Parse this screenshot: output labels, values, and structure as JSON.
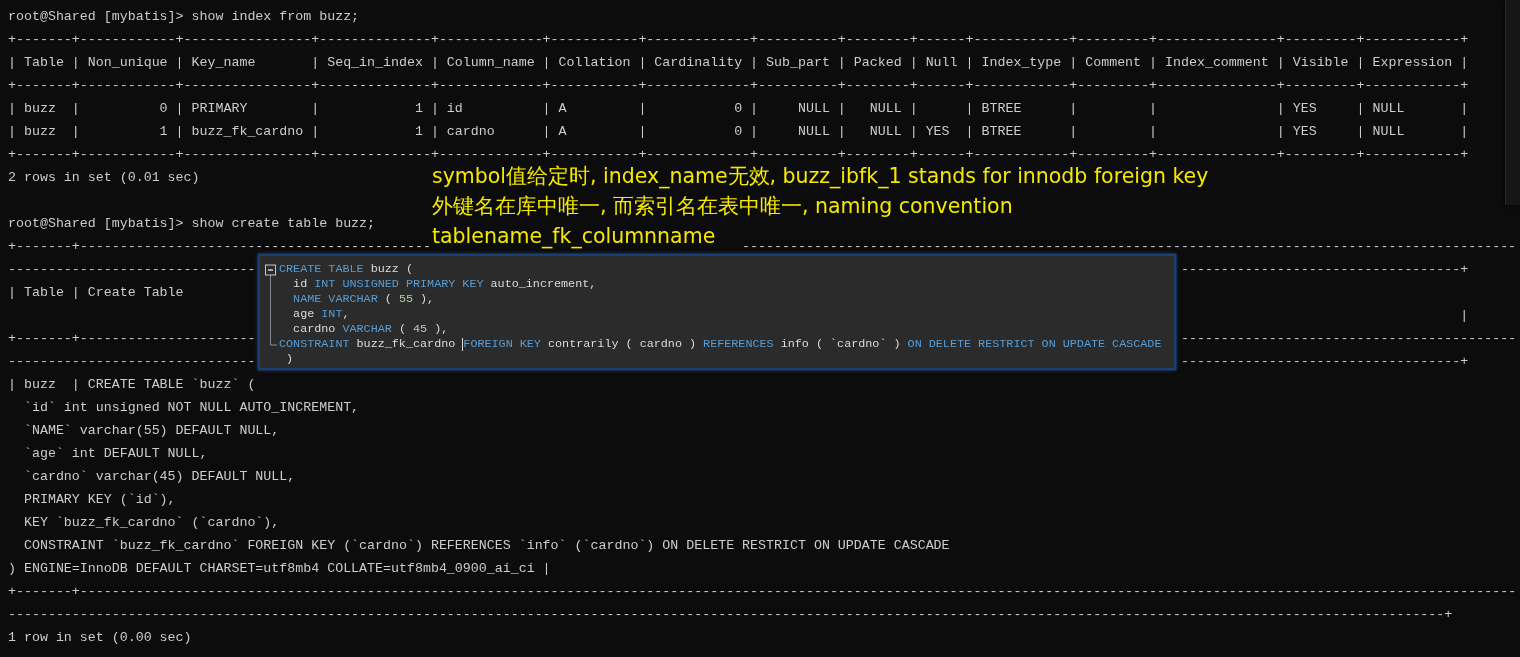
{
  "terminal": {
    "lines": [
      {
        "kind": "text",
        "text": "root@Shared [mybatis]> show index from buzz;"
      },
      {
        "kind": "text",
        "text": "+-------+------------+----------------+--------------+-------------+-----------+-------------+----------+--------+------+------------+---------+---------------+---------+------------+"
      },
      {
        "kind": "text",
        "text": "| Table | Non_unique | Key_name       | Seq_in_index | Column_name | Collation | Cardinality | Sub_part | Packed | Null | Index_type | Comment | Index_comment | Visible | Expression |"
      },
      {
        "kind": "text",
        "text": "+-------+------------+----------------+--------------+-------------+-----------+-------------+----------+--------+------+------------+---------+---------------+---------+------------+"
      },
      {
        "kind": "text",
        "text": "| buzz  |          0 | PRIMARY        |            1 | id          | A         |           0 |     NULL |   NULL |      | BTREE      |         |               | YES     | NULL       |"
      },
      {
        "kind": "text",
        "text": "| buzz  |          1 | buzz_fk_cardno |            1 | cardno      | A         |           0 |     NULL |   NULL | YES  | BTREE      |         |               | YES     | NULL       |"
      },
      {
        "kind": "text",
        "text": "+-------+------------+----------------+--------------+-------------+-----------+-------------+----------+--------+------+------------+---------+---------------+---------+------------+"
      },
      {
        "kind": "text",
        "text": "2 rows in set (0.01 sec)"
      },
      {
        "kind": "blank"
      },
      {
        "kind": "text",
        "text": "root@Shared [mybatis]> show create table buzz;"
      },
      {
        "kind": "split_wide",
        "left": "+-------+--------------------------------------------",
        "right": "-------------------------------------------------------------------------------------------------"
      },
      {
        "kind": "split",
        "left": "-------------------------------",
        "right": "-----------------------------------+"
      },
      {
        "kind": "text",
        "text": "| Table | Create Table"
      },
      {
        "kind": "right",
        "text": "|"
      },
      {
        "kind": "split_wide",
        "left": "+-------+----------------------",
        "right": "------------------------------------------"
      },
      {
        "kind": "split",
        "left": "-------------------------------",
        "right": "-----------------------------------+"
      },
      {
        "kind": "text",
        "text": "| buzz  | CREATE TABLE `buzz` ("
      },
      {
        "kind": "text",
        "text": "  `id` int unsigned NOT NULL AUTO_INCREMENT,"
      },
      {
        "kind": "text",
        "text": "  `NAME` varchar(55) DEFAULT NULL,"
      },
      {
        "kind": "text",
        "text": "  `age` int DEFAULT NULL,"
      },
      {
        "kind": "text",
        "text": "  `cardno` varchar(45) DEFAULT NULL,"
      },
      {
        "kind": "text",
        "text": "  PRIMARY KEY (`id`),"
      },
      {
        "kind": "text",
        "text": "  KEY `buzz_fk_cardno` (`cardno`),"
      },
      {
        "kind": "text",
        "text": "  CONSTRAINT `buzz_fk_cardno` FOREIGN KEY (`cardno`) REFERENCES `info` (`cardno`) ON DELETE RESTRICT ON UPDATE CASCADE"
      },
      {
        "kind": "text",
        "text": ") ENGINE=InnoDB DEFAULT CHARSET=utf8mb4 COLLATE=utf8mb4_0900_ai_ci |"
      },
      {
        "kind": "text",
        "text": "+-------+------------------------------------------------------------------------------------------------------------------------------------------------------------------------------------"
      },
      {
        "kind": "text",
        "text": "------------------------------------------------------------------------------------------------------------------------------------------------------------------------------------+"
      },
      {
        "kind": "text",
        "text": "1 row in set (0.00 sec)"
      }
    ]
  },
  "annotation": {
    "lines": [
      "symbol值给定时, index_name无效, buzz_ibfk_1 stands for innodb foreign key",
      "外键名在库中唯一, 而索引名在表中唯一, naming convention",
      "tablename_fk_columnname"
    ]
  },
  "popup": {
    "lines": [
      [
        {
          "kind": "keyword",
          "text": "CREATE TABLE"
        },
        {
          "kind": "ident",
          "text": " buzz ("
        }
      ],
      [
        {
          "kind": "ident",
          "text": "  id "
        },
        {
          "kind": "keyword",
          "text": "INT UNSIGNED PRIMARY KEY"
        },
        {
          "kind": "ident",
          "text": " auto_increment,"
        }
      ],
      [
        {
          "kind": "keyword",
          "text": "  NAME VARCHAR"
        },
        {
          "kind": "ident",
          "text": " ( "
        },
        {
          "kind": "number",
          "text": "55"
        },
        {
          "kind": "ident",
          "text": " ),"
        }
      ],
      [
        {
          "kind": "ident",
          "text": "  age "
        },
        {
          "kind": "keyword",
          "text": "INT"
        },
        {
          "kind": "ident",
          "text": ","
        }
      ],
      [
        {
          "kind": "ident",
          "text": "  cardno "
        },
        {
          "kind": "keyword",
          "text": "VARCHAR"
        },
        {
          "kind": "ident",
          "text": " ( "
        },
        {
          "kind": "number",
          "text": "45"
        },
        {
          "kind": "ident",
          "text": " ),"
        }
      ],
      [
        {
          "kind": "keyword",
          "text": "CONSTRAINT"
        },
        {
          "kind": "ident",
          "text": " buzz_fk_cardno "
        },
        {
          "kind": "cursor"
        },
        {
          "kind": "keyword",
          "text": "FOREIGN KEY"
        },
        {
          "kind": "ident",
          "text": " contrarily ( cardno ) "
        },
        {
          "kind": "keyword",
          "text": "REFERENCES"
        },
        {
          "kind": "ident",
          "text": " info ( `cardno` ) "
        },
        {
          "kind": "keyword",
          "text": "ON DELETE RESTRICT ON UPDATE CASCADE"
        }
      ],
      [
        {
          "kind": "ident",
          "text": " )"
        }
      ]
    ]
  }
}
